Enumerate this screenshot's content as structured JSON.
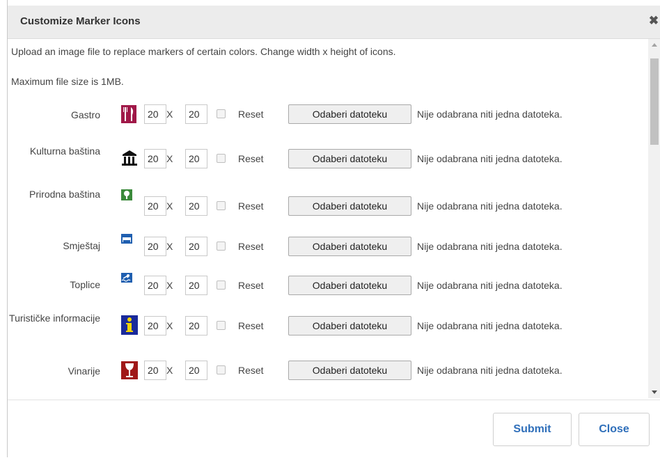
{
  "dialog": {
    "title": "Customize Marker Icons",
    "close_glyph": "✖",
    "intro_line1": "Upload an image file to replace markers of certain colors. Change width x height of icons.",
    "intro_line2": "Maximum file size is 1MB.",
    "rows": [
      {
        "category": "Gastro",
        "icon": "cutlery-icon",
        "width": "20",
        "height": "20",
        "times": "X",
        "reset_label": "Reset",
        "file_button": "Odaberi datoteku",
        "file_status": "Nije odabrana niti jedna datoteka."
      },
      {
        "category": "Kulturna baština",
        "icon": "museum-icon",
        "width": "20",
        "height": "20",
        "times": "X",
        "reset_label": "Reset",
        "file_button": "Odaberi datoteku",
        "file_status": "Nije odabrana niti jedna datoteka."
      },
      {
        "category": "Prirodna baština",
        "icon": "tree-icon",
        "width": "20",
        "height": "20",
        "times": "X",
        "reset_label": "Reset",
        "file_button": "Odaberi datoteku",
        "file_status": "Nije odabrana niti jedna datoteka."
      },
      {
        "category": "Smještaj",
        "icon": "bed-icon",
        "width": "20",
        "height": "20",
        "times": "X",
        "reset_label": "Reset",
        "file_button": "Odaberi datoteku",
        "file_status": "Nije odabrana niti jedna datoteka."
      },
      {
        "category": "Toplice",
        "icon": "spa-swimmer-icon",
        "width": "20",
        "height": "20",
        "times": "X",
        "reset_label": "Reset",
        "file_button": "Odaberi datoteku",
        "file_status": "Nije odabrana niti jedna datoteka."
      },
      {
        "category": "Turističke informacije",
        "icon": "info-icon",
        "width": "20",
        "height": "20",
        "times": "X",
        "reset_label": "Reset",
        "file_button": "Odaberi datoteku",
        "file_status": "Nije odabrana niti jedna datoteka."
      },
      {
        "category": "Vinarije",
        "icon": "wine-glass-icon",
        "width": "20",
        "height": "20",
        "times": "X",
        "reset_label": "Reset",
        "file_button": "Odaberi datoteku",
        "file_status": "Nije odabrana niti jedna datoteka."
      }
    ]
  },
  "footer": {
    "submit_label": "Submit",
    "close_label": "Close"
  },
  "colors": {
    "accent": "#2f6fba",
    "titlebar_bg": "#ececec"
  }
}
